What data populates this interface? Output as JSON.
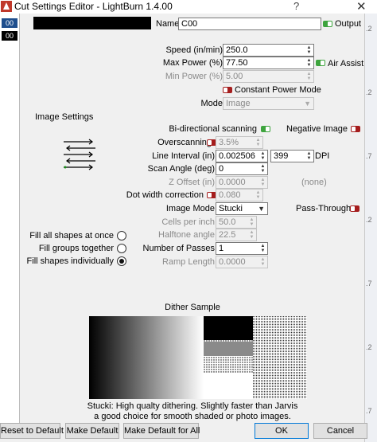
{
  "window": {
    "title": "Cut Settings Editor - LightBurn 1.4.00",
    "help_glyph": "?",
    "close_glyph": "✕"
  },
  "layers": [
    {
      "label": "00",
      "color": "#1f4e8c"
    },
    {
      "label": "00",
      "color": "#000000"
    }
  ],
  "background_ticks": [
    ".2",
    ".2",
    ".7",
    ".2",
    ".7",
    ".2",
    ".7"
  ],
  "header": {
    "layer_color": "#000000",
    "name_label": "Name",
    "name_value": "C00",
    "output_label": "Output",
    "output_on": true
  },
  "main": {
    "speed_label": "Speed (in/min)",
    "speed_value": "250.0",
    "max_power_label": "Max Power (%)",
    "max_power_value": "77.50",
    "air_assist_label": "Air Assist",
    "air_assist_on": true,
    "min_power_label": "Min Power (%)",
    "min_power_value": "5.00",
    "constant_power_label": "Constant Power Mode",
    "constant_power_on": false,
    "mode_label": "Mode",
    "mode_value": "Image"
  },
  "image_settings": {
    "section_label": "Image Settings",
    "bidirectional_label": "Bi-directional scanning",
    "bidirectional_on": true,
    "negative_label": "Negative Image",
    "negative_on": false,
    "overscanning_label": "Overscanning",
    "overscanning_value": "3.5%",
    "line_interval_label": "Line Interval (in)",
    "line_interval_value": "0.002506",
    "dpi_value": "399",
    "dpi_label": "DPI",
    "scan_angle_label": "Scan Angle (deg)",
    "scan_angle_value": "0",
    "z_offset_label": "Z Offset (in)",
    "z_offset_value": "0.0000",
    "z_offset_note": "(none)",
    "dot_width_label": "Dot width correction",
    "dot_width_value": "0.080",
    "image_mode_label": "Image Mode",
    "image_mode_value": "Stucki",
    "pass_through_label": "Pass-Through",
    "pass_through_on": false,
    "cells_label": "Cells per inch",
    "cells_value": "50.0",
    "halftone_label": "Halftone angle",
    "halftone_value": "22.5",
    "passes_label": "Number of Passes",
    "passes_value": "1",
    "ramp_label": "Ramp Length",
    "ramp_value": "0.0000"
  },
  "fill_options": [
    {
      "label": "Fill all shapes at once",
      "checked": false
    },
    {
      "label": "Fill groups together",
      "checked": false
    },
    {
      "label": "Fill shapes individually",
      "checked": true
    }
  ],
  "dither": {
    "title": "Dither Sample",
    "description_line1": "Stucki: High qualty dithering. Slightly faster than Jarvis",
    "description_line2": "a good choice for smooth shaded or photo images."
  },
  "buttons": {
    "reset": "Reset to Default",
    "make_default": "Make Default",
    "make_default_all": "Make Default for All",
    "ok": "OK",
    "cancel": "Cancel"
  }
}
